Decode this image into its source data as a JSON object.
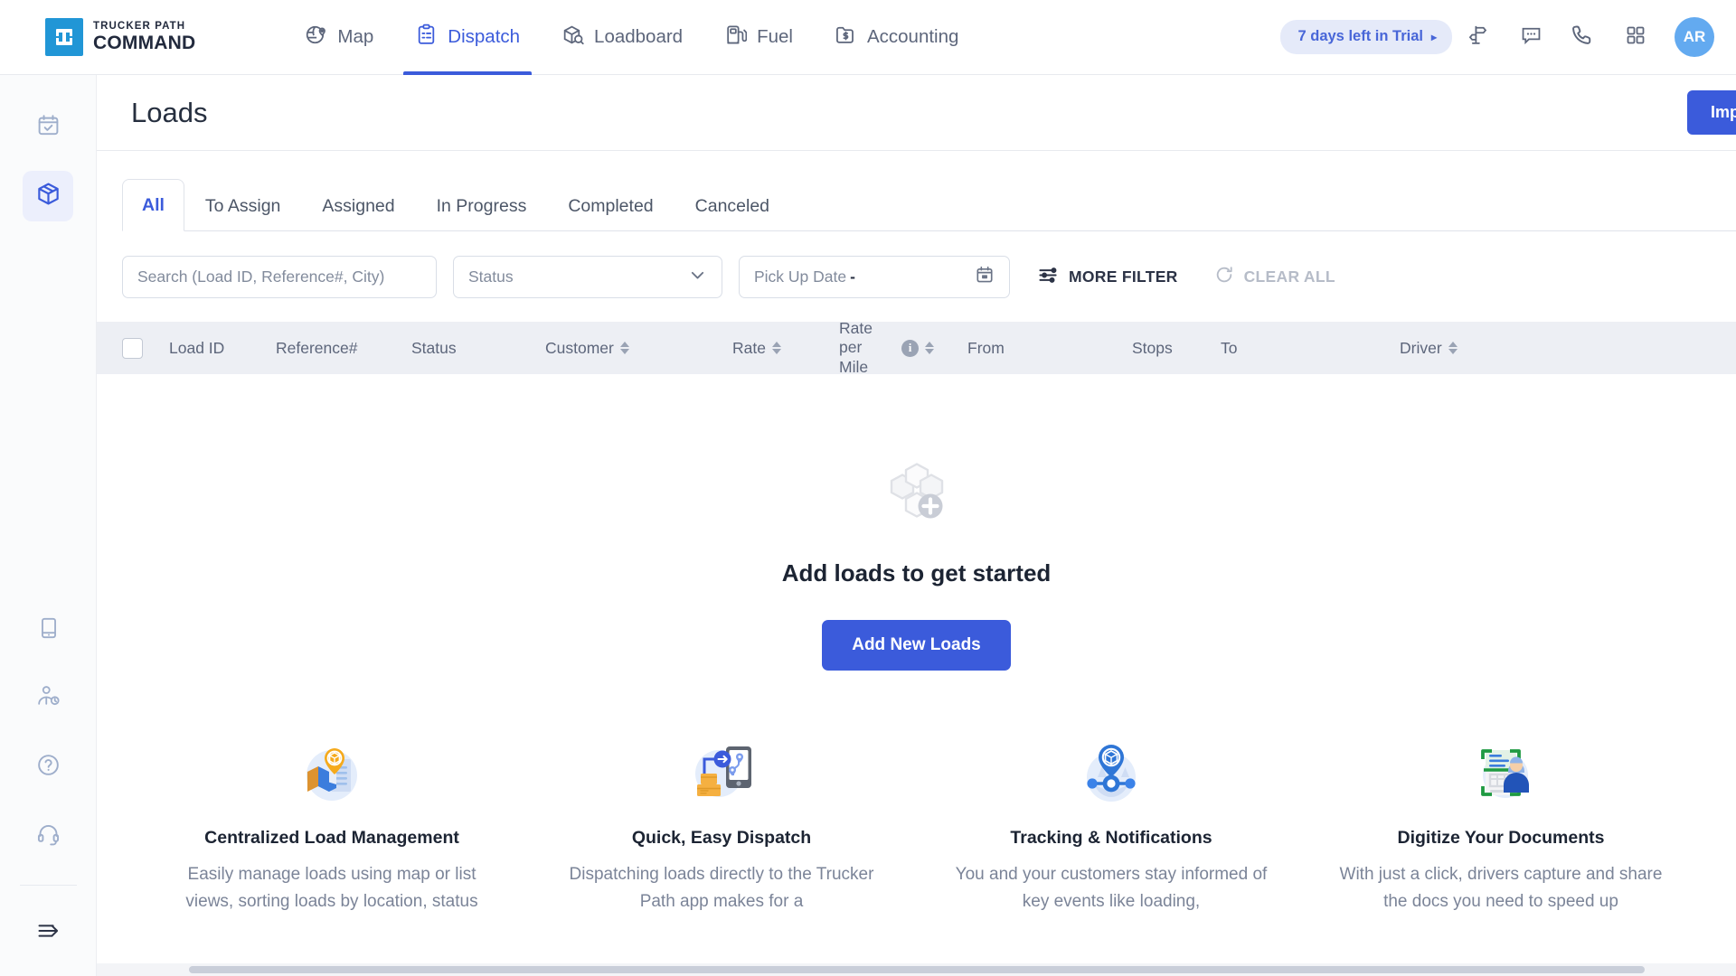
{
  "brand": {
    "line1": "TRUCKER PATH",
    "line2": "COMMAND",
    "logo_color": "#2196d6",
    "mark_icon": "truck-chassis-icon"
  },
  "topnav": {
    "items": [
      {
        "label": "Map",
        "icon": "globe-pin-icon",
        "active": false
      },
      {
        "label": "Dispatch",
        "icon": "clipboard-list-icon",
        "active": true
      },
      {
        "label": "Loadboard",
        "icon": "box-search-icon",
        "active": false
      },
      {
        "label": "Fuel",
        "icon": "fuel-pump-icon",
        "active": false
      },
      {
        "label": "Accounting",
        "icon": "folder-dollar-icon",
        "active": false
      }
    ],
    "active_index": 1,
    "active_color": "#3b5bdb",
    "trial_badge": {
      "label": "7 days left in Trial",
      "caret": "▸",
      "bg": "#e5eaf9",
      "fg": "#4866d8"
    },
    "icons": [
      {
        "name": "signpost-icon"
      },
      {
        "name": "chat-bubble-icon"
      },
      {
        "name": "phone-icon"
      },
      {
        "name": "apps-grid-icon"
      }
    ],
    "avatar": {
      "initials": "AR",
      "bg": "#63aaf0"
    }
  },
  "rail": {
    "top_items": [
      {
        "icon": "calendar-check-icon",
        "active": false
      },
      {
        "icon": "package-box-icon",
        "active": true
      }
    ],
    "bottom_items": [
      {
        "icon": "mobile-device-icon"
      },
      {
        "icon": "driver-hours-icon"
      },
      {
        "icon": "help-circle-icon"
      },
      {
        "icon": "headset-support-icon"
      },
      {
        "icon": "expand-arrow-icon"
      }
    ],
    "active_bg": "#eceffc",
    "active_fg": "#3b5bdb"
  },
  "page": {
    "title": "Loads",
    "import_label": "Import"
  },
  "tabs": {
    "items": [
      {
        "label": "All",
        "active": true
      },
      {
        "label": "To Assign",
        "active": false
      },
      {
        "label": "Assigned",
        "active": false
      },
      {
        "label": "In Progress",
        "active": false
      },
      {
        "label": "Completed",
        "active": false
      },
      {
        "label": "Canceled",
        "active": false
      }
    ],
    "active_index": 0
  },
  "filters": {
    "search_placeholder": "Search (Load ID, Reference#, City)",
    "search_value": "",
    "status_label": "Status",
    "status_value": "",
    "pickup_label": "Pick Up Date",
    "pickup_dash": "-",
    "pickup_value": "",
    "calendar_icon": "calendar-icon",
    "more_filter_label": "MORE FILTER",
    "more_filter_icon": "filter-sliders-icon",
    "clear_all_label": "CLEAR ALL",
    "clear_all_icon": "refresh-icon"
  },
  "table": {
    "select_all_checked": false,
    "columns": [
      {
        "label": "Load ID",
        "sortable": false,
        "info": false
      },
      {
        "label": "Reference#",
        "sortable": false,
        "info": false
      },
      {
        "label": "Status",
        "sortable": false,
        "info": false
      },
      {
        "label": "Customer",
        "sortable": true,
        "info": false
      },
      {
        "label": "Rate",
        "sortable": true,
        "info": false
      },
      {
        "label": "Rate per Mile",
        "sortable": true,
        "info": true
      },
      {
        "label": "From",
        "sortable": false,
        "info": false
      },
      {
        "label": "Stops",
        "sortable": false,
        "info": false
      },
      {
        "label": "To",
        "sortable": false,
        "info": false
      },
      {
        "label": "Driver",
        "sortable": true,
        "info": false
      }
    ],
    "rows": [],
    "header_bg": "#edeff4"
  },
  "empty_state": {
    "icon": "add-boxes-icon",
    "title": "Add loads to get started",
    "button_label": "Add New Loads",
    "button_color": "#3b5bdb"
  },
  "features": [
    {
      "icon": "map-load-pin-icon",
      "title": "Centralized Load Management",
      "desc": "Easily manage loads using map or list views, sorting loads by location, status"
    },
    {
      "icon": "dispatch-phone-icon",
      "title": "Quick, Easy Dispatch",
      "desc": "Dispatching loads directly to the Trucker Path app makes for a"
    },
    {
      "icon": "tracking-pin-icon",
      "title": "Tracking & Notifications",
      "desc": "You and your customers stay informed of key events like loading,"
    },
    {
      "icon": "scan-document-icon",
      "title": "Digitize Your Documents",
      "desc": "With just a click, drivers capture and share the docs you need to speed up"
    }
  ]
}
